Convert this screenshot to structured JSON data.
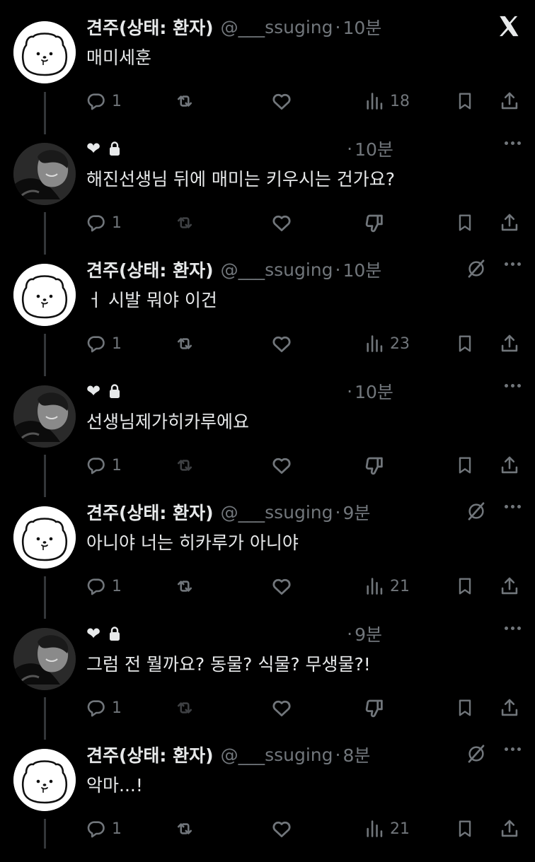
{
  "thread": [
    {
      "kind": "author",
      "name": "견주(상태: 환자)",
      "handle": "@___ssuging",
      "time": "10분",
      "text": "매미세훈",
      "replies": "1",
      "views": "18",
      "corner": "x"
    },
    {
      "kind": "reply",
      "badge": "❤",
      "time": "10분",
      "text": "해진선생님 뒤에 매미는 키우시는 건가요?",
      "replies": "1"
    },
    {
      "kind": "author",
      "name": "견주(상태: 환자)",
      "handle": "@___ssuging",
      "time": "10분",
      "text": "ㅓ 시발 뭐야 이건",
      "replies": "1",
      "views": "23",
      "corner": "more"
    },
    {
      "kind": "reply",
      "badge": "❤",
      "time": "10분",
      "text": "선생님제가히카루에요",
      "replies": "1"
    },
    {
      "kind": "author",
      "name": "견주(상태: 환자)",
      "handle": "@___ssuging",
      "time": "9분",
      "text": "아니야 너는 히카루가 아니야",
      "replies": "1",
      "views": "21",
      "corner": "more"
    },
    {
      "kind": "reply",
      "badge": "❤",
      "time": "9분",
      "text": "그럼 전 뭘까요? 동물? 식물? 무생물?!",
      "replies": "1"
    },
    {
      "kind": "author",
      "name": "견주(상태: 환자)",
      "handle": "@___ssuging",
      "time": "8분",
      "text": "악마...!",
      "replies": "1",
      "views": "21",
      "corner": "more"
    }
  ],
  "dot_separator": "·",
  "colors": {
    "background": "#000000",
    "text": "#e7e9ea",
    "muted": "#71767b",
    "thread_line": "#333639"
  },
  "icons": {
    "reply": "reply-icon",
    "retweet": "retweet-icon",
    "like": "heart-icon",
    "views": "views-icon",
    "downvote": "downvote-icon",
    "bookmark": "bookmark-icon",
    "share": "share-icon",
    "lock": "lock-icon",
    "grok": "grok-icon",
    "close": "x-logo-icon",
    "more": "more-icon"
  }
}
